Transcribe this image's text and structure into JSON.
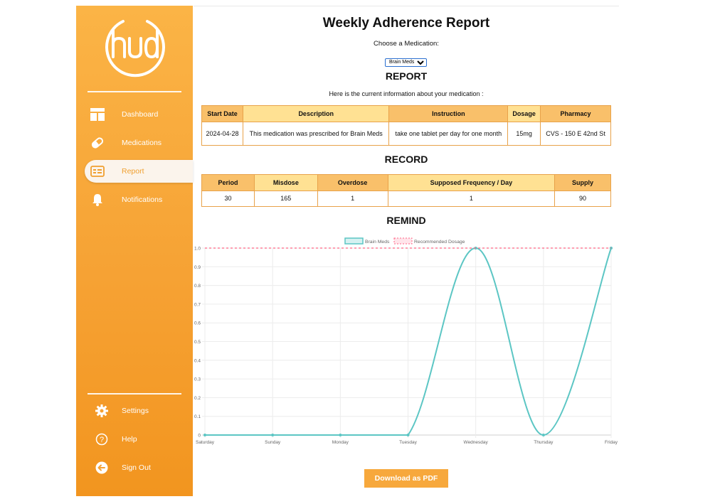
{
  "sidebar": {
    "logo_text": "hud",
    "items": [
      {
        "label": "Dashboard",
        "icon": "dashboard-icon"
      },
      {
        "label": "Medications",
        "icon": "pill-icon"
      },
      {
        "label": "Report",
        "icon": "report-icon",
        "active": true
      },
      {
        "label": "Notifications",
        "icon": "bell-icon"
      }
    ],
    "bottom_items": [
      {
        "label": "Settings",
        "icon": "gear-icon"
      },
      {
        "label": "Help",
        "icon": "help-icon"
      },
      {
        "label": "Sign Out",
        "icon": "sign-out-icon"
      }
    ]
  },
  "page": {
    "title": "Weekly Adherence Report",
    "choose_label": "Choose a Medication:",
    "selected_medication": "Brain Meds",
    "report_heading": "REPORT",
    "report_intro": "Here is the current information about your medication :",
    "record_heading": "RECORD",
    "remind_heading": "REMIND",
    "download_label": "Download as PDF"
  },
  "report_table": {
    "headers": [
      "Start Date",
      "Description",
      "Instruction",
      "Dosage",
      "Pharmacy"
    ],
    "row": [
      "2024-04-28",
      "This medication was prescribed for Brain Meds",
      "take one tablet per day for one month",
      "15mg",
      "CVS - 150 E 42nd St"
    ]
  },
  "record_table": {
    "headers": [
      "Period",
      "Misdose",
      "Overdose",
      "Supposed Frequency / Day",
      "Supply"
    ],
    "row": [
      "30",
      "165",
      "1",
      "1",
      "90"
    ]
  },
  "chart_data": {
    "type": "line",
    "categories": [
      "Saturday",
      "Sunday",
      "Monday",
      "Tuesday",
      "Wednesday",
      "Thursday",
      "Friday"
    ],
    "series": [
      {
        "name": "Brain Meds",
        "values": [
          0,
          0,
          0,
          0,
          1,
          0,
          1
        ],
        "color": "#5cc6c4"
      },
      {
        "name": "Recommended Dosage",
        "values": [
          1,
          1,
          1,
          1,
          1,
          1,
          1
        ],
        "color": "#ff6384",
        "dashed": true
      }
    ],
    "ylim": [
      0,
      1
    ],
    "yticks": [
      "0",
      "0.1",
      "0.2",
      "0.3",
      "0.4",
      "0.5",
      "0.6",
      "0.7",
      "0.8",
      "0.9",
      "1.0"
    ],
    "grid": true,
    "legend": "top-center"
  },
  "colors": {
    "sidebar": "#f6a234",
    "accent": "#f7a83c",
    "header_dark": "#f9c06a",
    "header_light": "#ffe193",
    "line": "#5cc6c4",
    "recommended": "#ff6384"
  }
}
